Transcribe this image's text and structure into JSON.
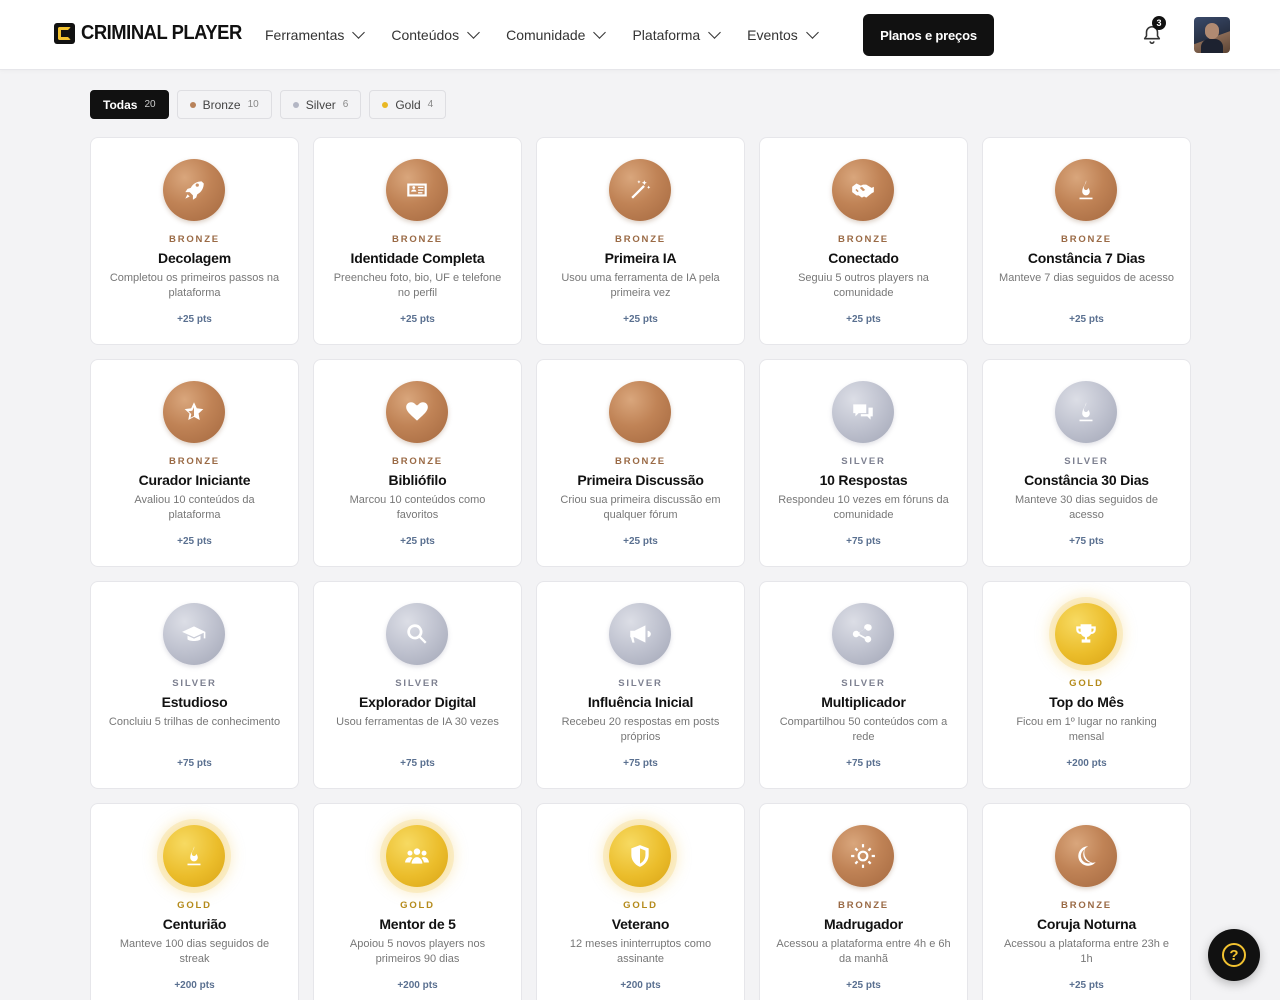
{
  "brand": {
    "name": "CRIMINAL PLAYER"
  },
  "nav": {
    "items": [
      {
        "label": "Ferramentas"
      },
      {
        "label": "Conteúdos"
      },
      {
        "label": "Comunidade"
      },
      {
        "label": "Plataforma"
      },
      {
        "label": "Eventos"
      }
    ],
    "cta": "Planos e preços"
  },
  "notifications": {
    "count": "3"
  },
  "help": {
    "label": "?"
  },
  "filters": [
    {
      "label": "Todas",
      "count": "20",
      "active": true,
      "dot": ""
    },
    {
      "label": "Bronze",
      "count": "10",
      "active": false,
      "dot": "#b8825a"
    },
    {
      "label": "Silver",
      "count": "6",
      "active": false,
      "dot": "#b3b6c4"
    },
    {
      "label": "Gold",
      "count": "4",
      "active": false,
      "dot": "#e9b824"
    }
  ],
  "colors": {
    "bronze": "#c08356",
    "silver": "#bfc2cf",
    "gold": "#ebbd2b",
    "accent": "#f2c230"
  },
  "badges": [
    {
      "tier": "bronze",
      "tier_label": "BRONZE",
      "icon": "rocket-icon",
      "title": "Decolagem",
      "desc": "Completou os primeiros passos na plataforma",
      "pts": "+25 pts"
    },
    {
      "tier": "bronze",
      "tier_label": "BRONZE",
      "icon": "id-card-icon",
      "title": "Identidade Completa",
      "desc": "Preencheu foto, bio, UF e telefone no perfil",
      "pts": "+25 pts"
    },
    {
      "tier": "bronze",
      "tier_label": "BRONZE",
      "icon": "magic-wand-icon",
      "title": "Primeira IA",
      "desc": "Usou uma ferramenta de IA pela primeira vez",
      "pts": "+25 pts"
    },
    {
      "tier": "bronze",
      "tier_label": "BRONZE",
      "icon": "handshake-icon",
      "title": "Conectado",
      "desc": "Seguiu 5 outros players na comunidade",
      "pts": "+25 pts"
    },
    {
      "tier": "bronze",
      "tier_label": "BRONZE",
      "icon": "flame-icon",
      "title": "Constância 7 Dias",
      "desc": "Manteve 7 dias seguidos de acesso",
      "pts": "+25 pts"
    },
    {
      "tier": "bronze",
      "tier_label": "BRONZE",
      "icon": "star-icon",
      "title": "Curador Iniciante",
      "desc": "Avaliou 10 conteúdos da plataforma",
      "pts": "+25 pts"
    },
    {
      "tier": "bronze",
      "tier_label": "BRONZE",
      "icon": "heart-icon",
      "title": "Bibliófilo",
      "desc": "Marcou 10 conteúdos como favoritos",
      "pts": "+25 pts"
    },
    {
      "tier": "bronze",
      "tier_label": "BRONZE",
      "icon": "none",
      "title": "Primeira Discussão",
      "desc": "Criou sua primeira discussão em qualquer fórum",
      "pts": "+25 pts"
    },
    {
      "tier": "silver",
      "tier_label": "SILVER",
      "icon": "chat-bubbles-icon",
      "title": "10 Respostas",
      "desc": "Respondeu 10 vezes em fóruns da comunidade",
      "pts": "+75 pts"
    },
    {
      "tier": "silver",
      "tier_label": "SILVER",
      "icon": "flame-icon",
      "title": "Constância 30 Dias",
      "desc": "Manteve 30 dias seguidos de acesso",
      "pts": "+75 pts"
    },
    {
      "tier": "silver",
      "tier_label": "SILVER",
      "icon": "graduation-cap-icon",
      "title": "Estudioso",
      "desc": "Concluiu 5 trilhas de conhecimento",
      "pts": "+75 pts"
    },
    {
      "tier": "silver",
      "tier_label": "SILVER",
      "icon": "search-icon",
      "title": "Explorador Digital",
      "desc": "Usou ferramentas de IA 30 vezes",
      "pts": "+75 pts"
    },
    {
      "tier": "silver",
      "tier_label": "SILVER",
      "icon": "megaphone-icon",
      "title": "Influência Inicial",
      "desc": "Recebeu 20 respostas em posts próprios",
      "pts": "+75 pts"
    },
    {
      "tier": "silver",
      "tier_label": "SILVER",
      "icon": "share-icon",
      "title": "Multiplicador",
      "desc": "Compartilhou 50 conteúdos com a rede",
      "pts": "+75 pts"
    },
    {
      "tier": "gold",
      "tier_label": "GOLD",
      "icon": "trophy-icon",
      "title": "Top do Mês",
      "desc": "Ficou em 1º lugar no ranking mensal",
      "pts": "+200 pts"
    },
    {
      "tier": "gold",
      "tier_label": "GOLD",
      "icon": "flame-icon",
      "title": "Centurião",
      "desc": "Manteve 100 dias seguidos de streak",
      "pts": "+200 pts"
    },
    {
      "tier": "gold",
      "tier_label": "GOLD",
      "icon": "users-icon",
      "title": "Mentor de 5",
      "desc": "Apoiou 5 novos players nos primeiros 90 dias",
      "pts": "+200 pts"
    },
    {
      "tier": "gold",
      "tier_label": "GOLD",
      "icon": "shield-icon",
      "title": "Veterano",
      "desc": "12 meses ininterruptos como assinante",
      "pts": "+200 pts"
    },
    {
      "tier": "bronze",
      "tier_label": "BRONZE",
      "icon": "sun-icon",
      "title": "Madrugador",
      "desc": "Acessou a plataforma entre 4h e 6h da manhã",
      "pts": "+25 pts"
    },
    {
      "tier": "bronze",
      "tier_label": "BRONZE",
      "icon": "moon-icon",
      "title": "Coruja Noturna",
      "desc": "Acessou a plataforma entre 23h e 1h",
      "pts": "+25 pts"
    }
  ]
}
